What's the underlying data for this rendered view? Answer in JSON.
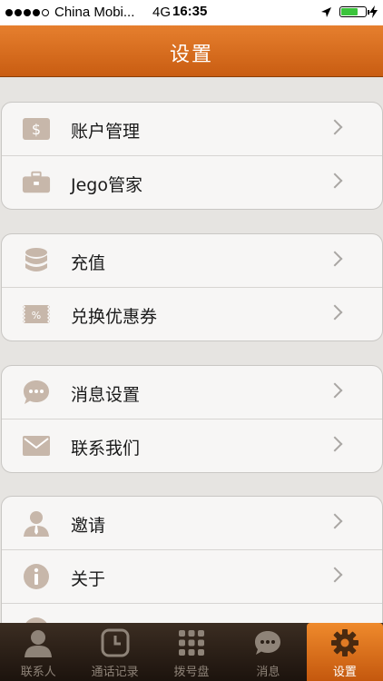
{
  "status": {
    "carrier": "China Mobi...",
    "network": "4G",
    "time": "16:35"
  },
  "nav": {
    "title": "设置"
  },
  "groups": [
    {
      "items": [
        {
          "label": "账户管理",
          "icon": "dollar-icon"
        },
        {
          "label": "Jego管家",
          "icon": "briefcase-icon"
        }
      ]
    },
    {
      "items": [
        {
          "label": "充值",
          "icon": "coins-icon"
        },
        {
          "label": "兑换优惠券",
          "icon": "coupon-icon"
        }
      ]
    },
    {
      "items": [
        {
          "label": "消息设置",
          "icon": "chat-bubble-icon"
        },
        {
          "label": "联系我们",
          "icon": "envelope-icon"
        }
      ]
    },
    {
      "items": [
        {
          "label": "邀请",
          "icon": "person-icon"
        },
        {
          "label": "关于",
          "icon": "info-icon"
        }
      ]
    }
  ],
  "tabs": [
    {
      "label": "联系人",
      "icon": "contact-icon"
    },
    {
      "label": "通话记录",
      "icon": "clock-icon"
    },
    {
      "label": "拨号盘",
      "icon": "keypad-icon"
    },
    {
      "label": "消息",
      "icon": "message-icon"
    },
    {
      "label": "设置",
      "icon": "gear-icon",
      "active": true
    }
  ],
  "colors": {
    "accent": "#e0731f",
    "tabbar": "#2a1f17",
    "icon": "#c3b3a6"
  }
}
